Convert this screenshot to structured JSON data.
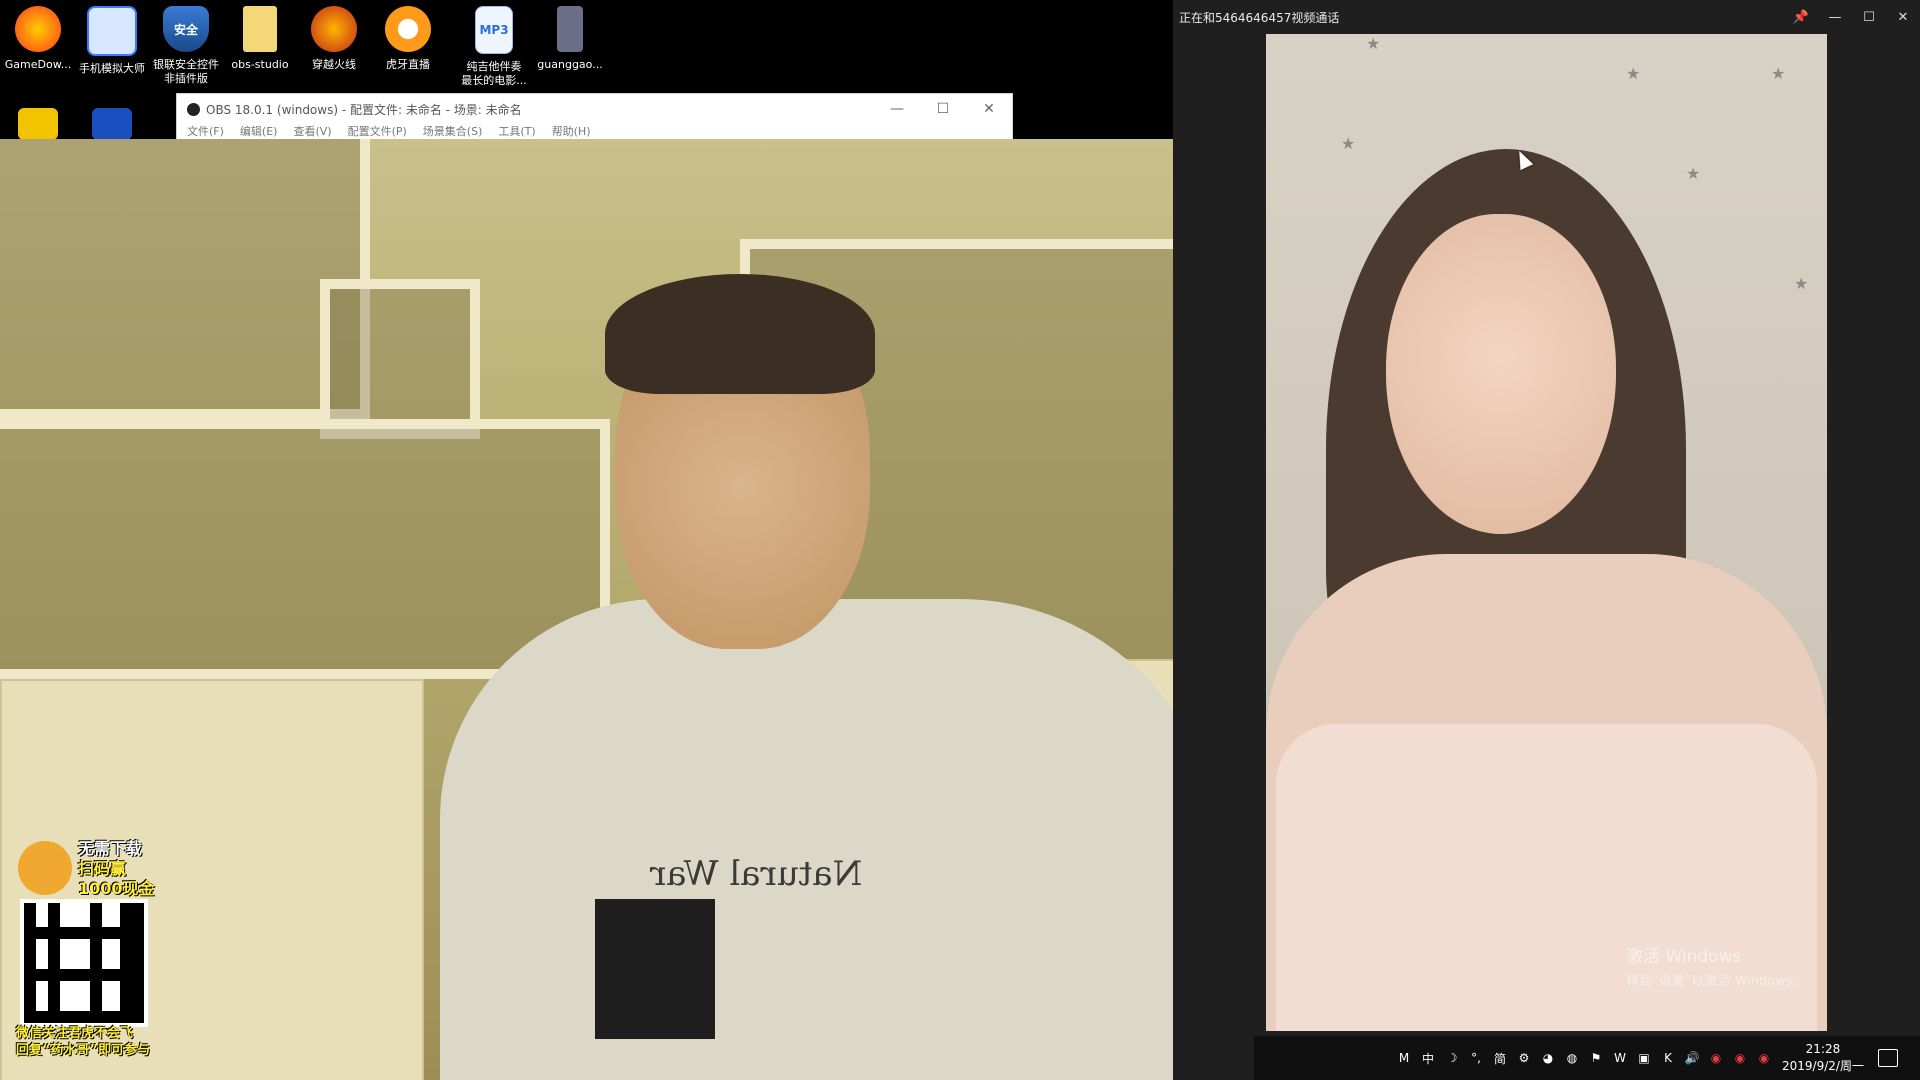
{
  "desktop": {
    "icons": [
      {
        "label": "GameDow...",
        "icon": "gamedown-icon"
      },
      {
        "label": "手机模拟大师",
        "icon": "phone-emulator-icon"
      },
      {
        "label": "银联安全控件\n非插件版",
        "icon": "unionpay-shield-icon"
      },
      {
        "label": "obs-studio",
        "icon": "folder-icon"
      },
      {
        "label": "穿越火线",
        "icon": "crossfire-icon"
      },
      {
        "label": "虎牙直播",
        "icon": "huya-icon"
      },
      {
        "label": "纯吉他伴奏\n最长的电影...",
        "icon": "mp3-file-icon"
      },
      {
        "label": "guanggao...",
        "icon": "app-bottle-icon"
      }
    ],
    "mp3_badge": "MP3",
    "shield_badge": "安全"
  },
  "obs": {
    "title": "OBS 18.0.1 (windows) - 配置文件: 未命名 - 场景: 未命名",
    "menu": [
      "文件(F)",
      "编辑(E)",
      "查看(V)",
      "配置文件(P)",
      "场景集合(S)",
      "工具(T)",
      "帮助(H)"
    ],
    "min_glyph": "—",
    "max_glyph": "☐",
    "close_glyph": "✕"
  },
  "promo": {
    "line1": "无需下载",
    "line2": "扫码赢",
    "line3": "1000现金",
    "caption1": "微信关注君虎不会飞",
    "caption2": "回复“药水哥”即可参与"
  },
  "shirt_print": "Natural War",
  "call": {
    "title": "正在和5464646457视频通话",
    "pin_glyph": "📌",
    "min_glyph": "—",
    "max_glyph": "☐",
    "close_glyph": "✕",
    "watermark_line1": "激活 Windows",
    "watermark_line2": "转到“设置”以激活 Windows。"
  },
  "taskbar": {
    "tray_items": [
      "M",
      "中",
      "☽",
      "°,",
      "简",
      "⚙",
      "◕",
      "◍",
      "⚑",
      "W",
      "▣",
      "K",
      "🔊",
      "◉",
      "◉",
      "◉"
    ],
    "time": "21:28",
    "date": "2019/9/2/周一"
  },
  "colors": {
    "promo_yellow": "#ffef3a",
    "call_bg": "#1f1f1f",
    "taskbar_bg": "#101010"
  }
}
